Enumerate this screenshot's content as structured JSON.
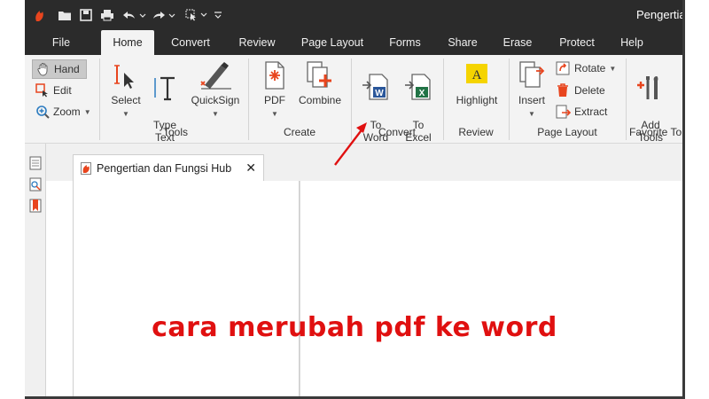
{
  "window": {
    "title": "Pengertia"
  },
  "menu_tabs": [
    "File",
    "Home",
    "Convert",
    "Review",
    "Page Layout",
    "Forms",
    "Share",
    "Erase",
    "Protect",
    "Help"
  ],
  "active_tab": "Home",
  "ribbon": {
    "hand_label": "Hand",
    "edit_label": "Edit",
    "zoom_label": "Zoom",
    "select_label": "Select",
    "type_text_label": "Type\nText",
    "quicksign_label": "QuickSign",
    "tools_group": "Tools",
    "pdf_label": "PDF",
    "combine_label": "Combine",
    "create_group": "Create",
    "to_word_label": "To\nWord",
    "to_excel_label": "To\nExcel",
    "convert_group": "Convert",
    "highlight_label": "Highlight",
    "review_group": "Review",
    "insert_label": "Insert",
    "rotate_label": "Rotate",
    "delete_label": "Delete",
    "extract_label": "Extract",
    "page_layout_group": "Page Layout",
    "add_tools_label": "Add\nTools",
    "favorite_group": "Favorite To"
  },
  "document_tab": {
    "title": "Pengertian dan Fungsi Hub",
    "close": "✕"
  },
  "caption": "cara merubah pdf ke word",
  "colors": {
    "accent_red": "#e01010",
    "dark_bar": "#2b2b2b",
    "word_blue": "#2b579a",
    "excel_green": "#217346"
  }
}
